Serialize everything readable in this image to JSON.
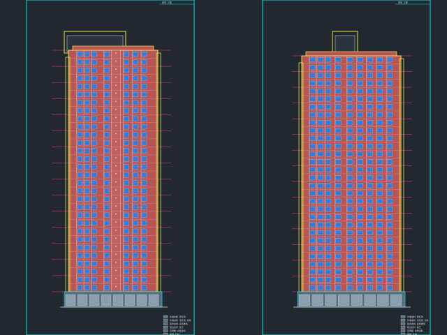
{
  "drawing": {
    "sheets": [
      {
        "name": "left-elevation",
        "title_block_text": "建筑 立面",
        "legend": [
          "外墙涂料 砖红色",
          "外墙涂料 浅灰色 线条",
          "铝合金窗 蓝色玻璃",
          "阳台栏杆 铁艺",
          "空调板 白色涂料",
          "底层 石材"
        ]
      },
      {
        "name": "right-elevation",
        "title_block_text": "建筑 立面",
        "legend": [
          "外墙涂料 砖红色",
          "外墙涂料 浅灰色 线条",
          "铝合金窗 蓝色玻璃",
          "阳台栏杆 铁艺",
          "空调板 白色涂料",
          "底层 石材"
        ]
      }
    ],
    "colors": {
      "background": "#212830",
      "frame": "#00e5e5",
      "facade": "#b85555",
      "window": "#3a7bd5",
      "outline": "#e8e84a",
      "level_line": "#ff2fa0",
      "white_line": "#e0e0e0"
    },
    "floor_count": 30
  }
}
